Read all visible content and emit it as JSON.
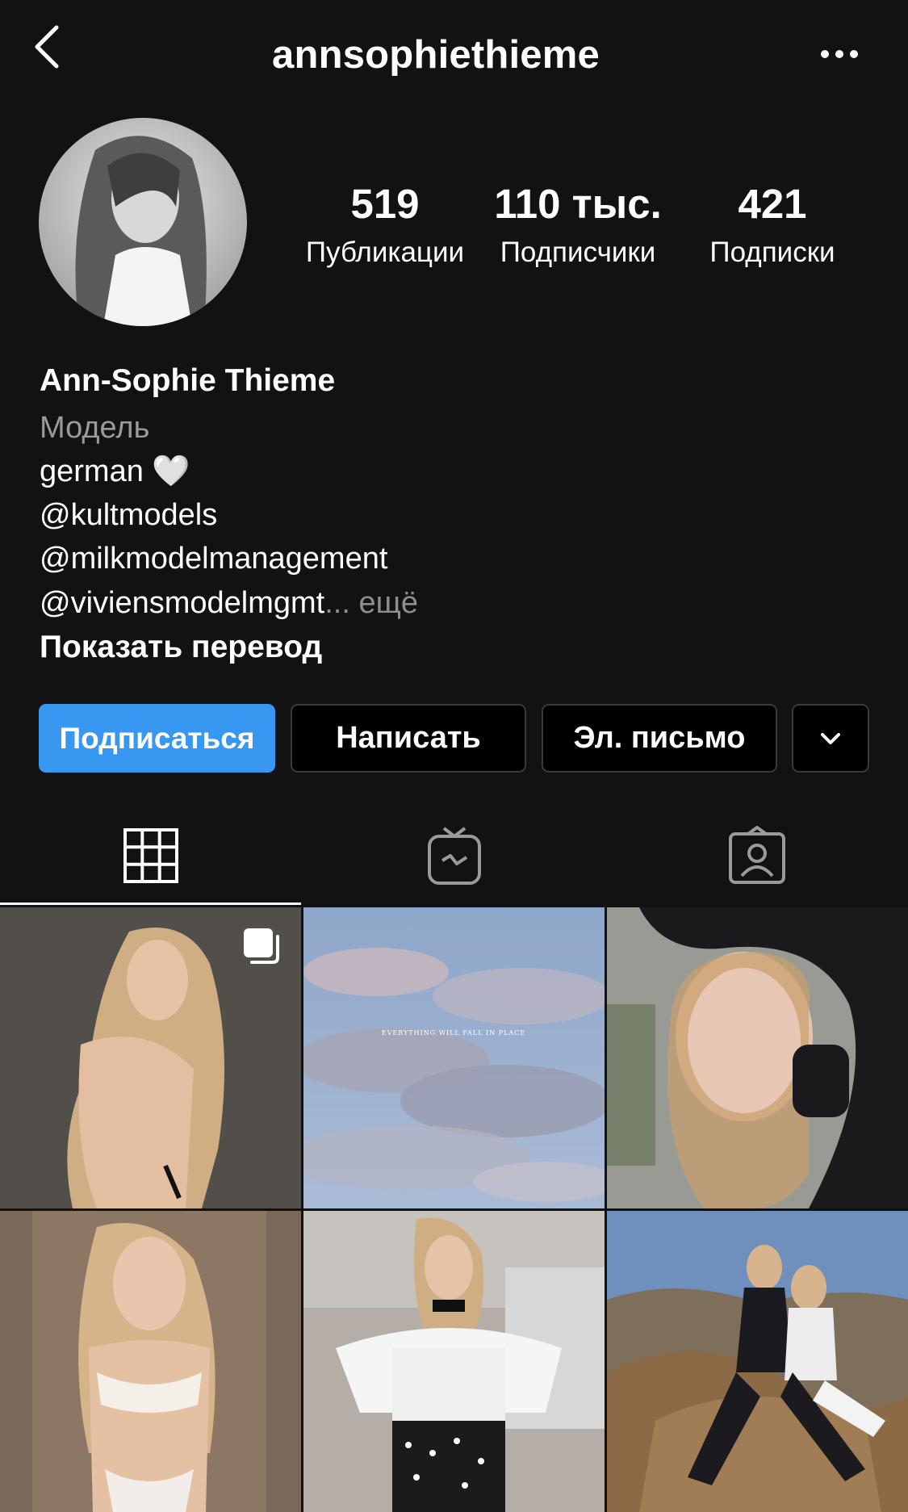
{
  "header": {
    "username": "annsophiethieme",
    "back_icon": "chevron-left-icon",
    "more_icon": "ellipsis-icon"
  },
  "stats": {
    "posts": {
      "value": "519",
      "label": "Публикации"
    },
    "followers": {
      "value": "110 тыс.",
      "label": "Подписчики"
    },
    "following": {
      "value": "421",
      "label": "Подписки"
    }
  },
  "bio": {
    "full_name": "Ann-Sophie Thieme",
    "category": "Модель",
    "line1": "german",
    "line1_emoji": "🤍",
    "line2": "@kultmodels",
    "line3": "@milkmodelmanagement",
    "line4": "@viviensmodelmgmt",
    "ellipsis": "...",
    "more": " ещё",
    "translate": "Показать перевод"
  },
  "actions": {
    "follow": "Подписаться",
    "message": "Написать",
    "email": "Эл. письмо",
    "more_icon": "chevron-down-icon"
  },
  "tabs": [
    {
      "icon": "grid-icon",
      "active": true
    },
    {
      "icon": "igtv-icon",
      "active": false
    },
    {
      "icon": "tagged-icon",
      "active": false
    }
  ],
  "posts": [
    {
      "subject": "photo",
      "multi": true
    },
    {
      "subject": "sky",
      "caption": "EVERYTHING WILL FALL IN PLACE"
    },
    {
      "subject": "photo"
    },
    {
      "subject": "photo"
    },
    {
      "subject": "photo"
    },
    {
      "subject": "photo"
    }
  ],
  "colors": {
    "background": "#121212",
    "accent": "#3897f0",
    "muted": "#8e8e8e"
  }
}
